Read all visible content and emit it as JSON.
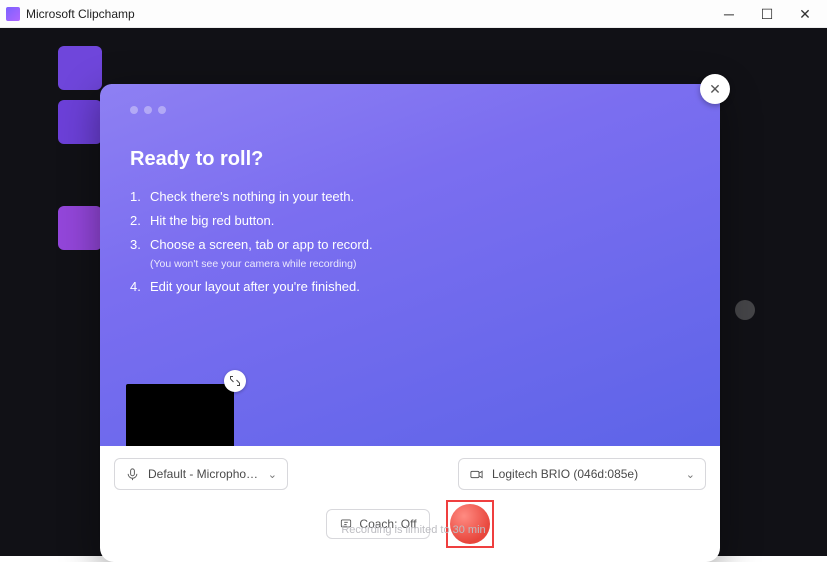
{
  "window": {
    "title": "Microsoft Clipchamp"
  },
  "panel": {
    "heading": "Ready to roll?",
    "steps": [
      {
        "text": "Check there's nothing in your teeth."
      },
      {
        "text": "Hit the big red button."
      },
      {
        "text": "Choose a screen, tab or app to record.",
        "sub": "(You won't see your camera while recording)"
      },
      {
        "text": "Edit your layout after you're finished."
      }
    ]
  },
  "controls": {
    "mic": {
      "label": "Default - Microphone (Lo..."
    },
    "camera": {
      "label": "Logitech BRIO (046d:085e)"
    },
    "coach": {
      "label": "Coach: Off"
    }
  },
  "footer": {
    "note": "Recording is limited to 30 min"
  }
}
